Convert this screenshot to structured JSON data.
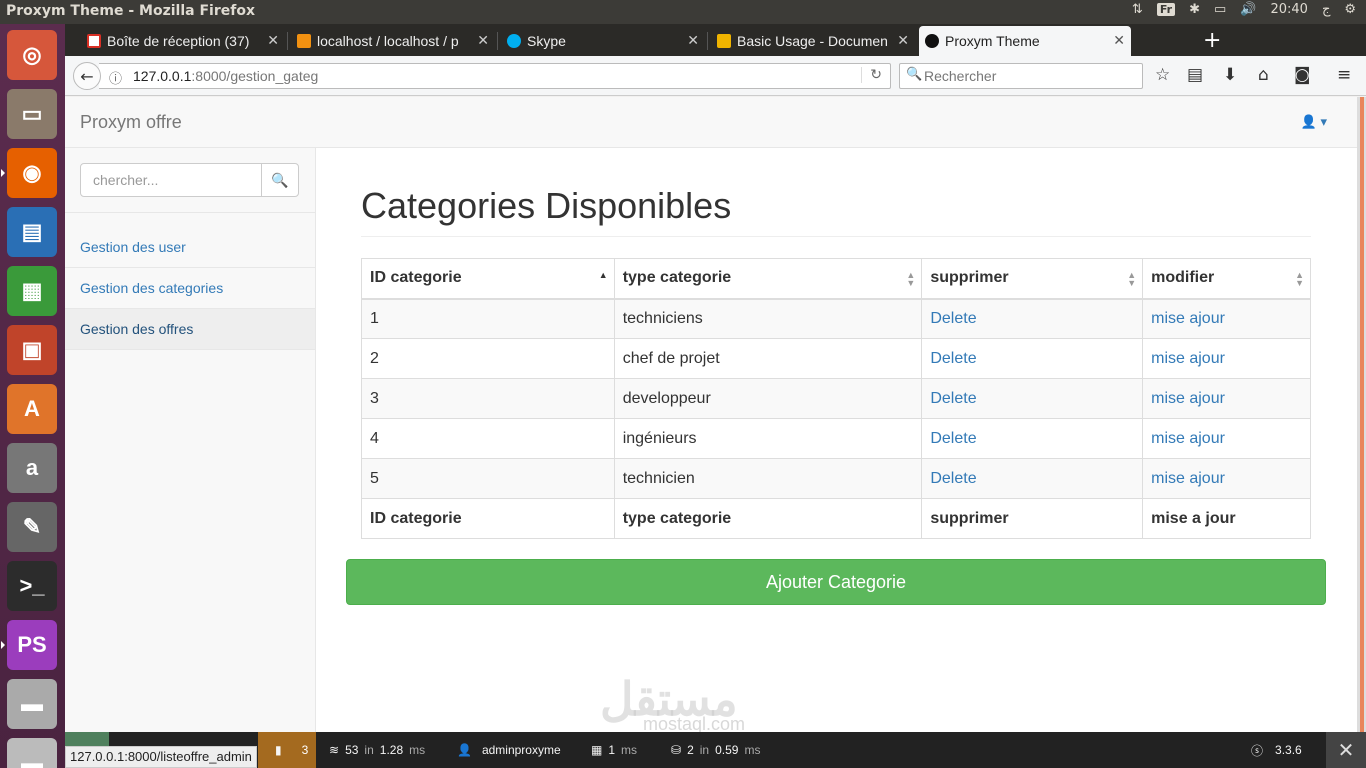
{
  "os_panel": {
    "window_title": "Proxym Theme - Mozilla Firefox",
    "keyboard_layout": "Fr",
    "time": "20:40",
    "locale_glyph": "ج"
  },
  "launcher": {
    "items": [
      {
        "name": "dash-icon",
        "color": "#d6573b"
      },
      {
        "name": "files-icon",
        "color": "#8a7a6a"
      },
      {
        "name": "firefox-icon",
        "color": "#e66000"
      },
      {
        "name": "writer-icon",
        "color": "#2a6fb5"
      },
      {
        "name": "calc-icon",
        "color": "#3a9a3a"
      },
      {
        "name": "impress-icon",
        "color": "#c0442a"
      },
      {
        "name": "software-center-icon",
        "color": "#e0742a"
      },
      {
        "name": "amazon-icon",
        "color": "#777777"
      },
      {
        "name": "settings-icon",
        "color": "#666666"
      },
      {
        "name": "terminal-icon",
        "color": "#2c2c2c"
      },
      {
        "name": "phpstorm-icon",
        "color": "#9b3dbd"
      },
      {
        "name": "drive-icon",
        "color": "#aaaaaa"
      },
      {
        "name": "trash-icon",
        "color": "#bbbbbb"
      }
    ]
  },
  "browser": {
    "tabs": [
      {
        "label": "Boîte de réception (37)",
        "favicon": "gmail-icon",
        "color": "#d93025"
      },
      {
        "label": "localhost / localhost / p",
        "favicon": "phpmyadmin-icon",
        "color": "#f29111"
      },
      {
        "label": "Skype",
        "favicon": "skype-icon",
        "color": "#00aff0"
      },
      {
        "label": "Basic Usage - Documen",
        "favicon": "grid-icon",
        "color": "#f0b400"
      },
      {
        "label": "Proxym Theme",
        "favicon": "symfony-icon",
        "color": "#111111"
      }
    ],
    "url_host": "127.0.0.1",
    "url_rest": ":8000/gestion_gateg",
    "search_placeholder": "Rechercher",
    "status_url": "127.0.0.1:8000/listeoffre_admin"
  },
  "site": {
    "brand": "Proxym offre",
    "search_placeholder": "chercher...",
    "nav": [
      {
        "label": "Gestion des user",
        "active": false
      },
      {
        "label": "Gestion des categories",
        "active": false
      },
      {
        "label": "Gestion des offres",
        "active": true
      }
    ],
    "page_title": "Categories Disponibles",
    "table": {
      "headers": [
        "ID categorie",
        "type categorie",
        "supprimer",
        "modifier"
      ],
      "rows": [
        {
          "id": "1",
          "type": "techniciens",
          "delete": "Delete",
          "edit": "mise ajour"
        },
        {
          "id": "2",
          "type": "chef de projet",
          "delete": "Delete",
          "edit": "mise ajour"
        },
        {
          "id": "3",
          "type": "developpeur",
          "delete": "Delete",
          "edit": "mise ajour"
        },
        {
          "id": "4",
          "type": "ingénieurs",
          "delete": "Delete",
          "edit": "mise ajour"
        },
        {
          "id": "5",
          "type": "technicien",
          "delete": "Delete",
          "edit": "mise ajour"
        }
      ],
      "footers": [
        "ID categorie",
        "type categorie",
        "supprimer",
        "mise a jour"
      ]
    },
    "add_button": "Ajouter Categorie",
    "watermark": "مستقل",
    "watermark_sub": "mostaql.com"
  },
  "debug_toolbar": {
    "errors": "3",
    "queries_a": "53",
    "in_label": "in",
    "time_a": "1.28",
    "ms": "ms",
    "user": "adminproxyme",
    "form_time": "1",
    "db_count": "2",
    "db_time": "0.59",
    "version": "3.3.6"
  }
}
